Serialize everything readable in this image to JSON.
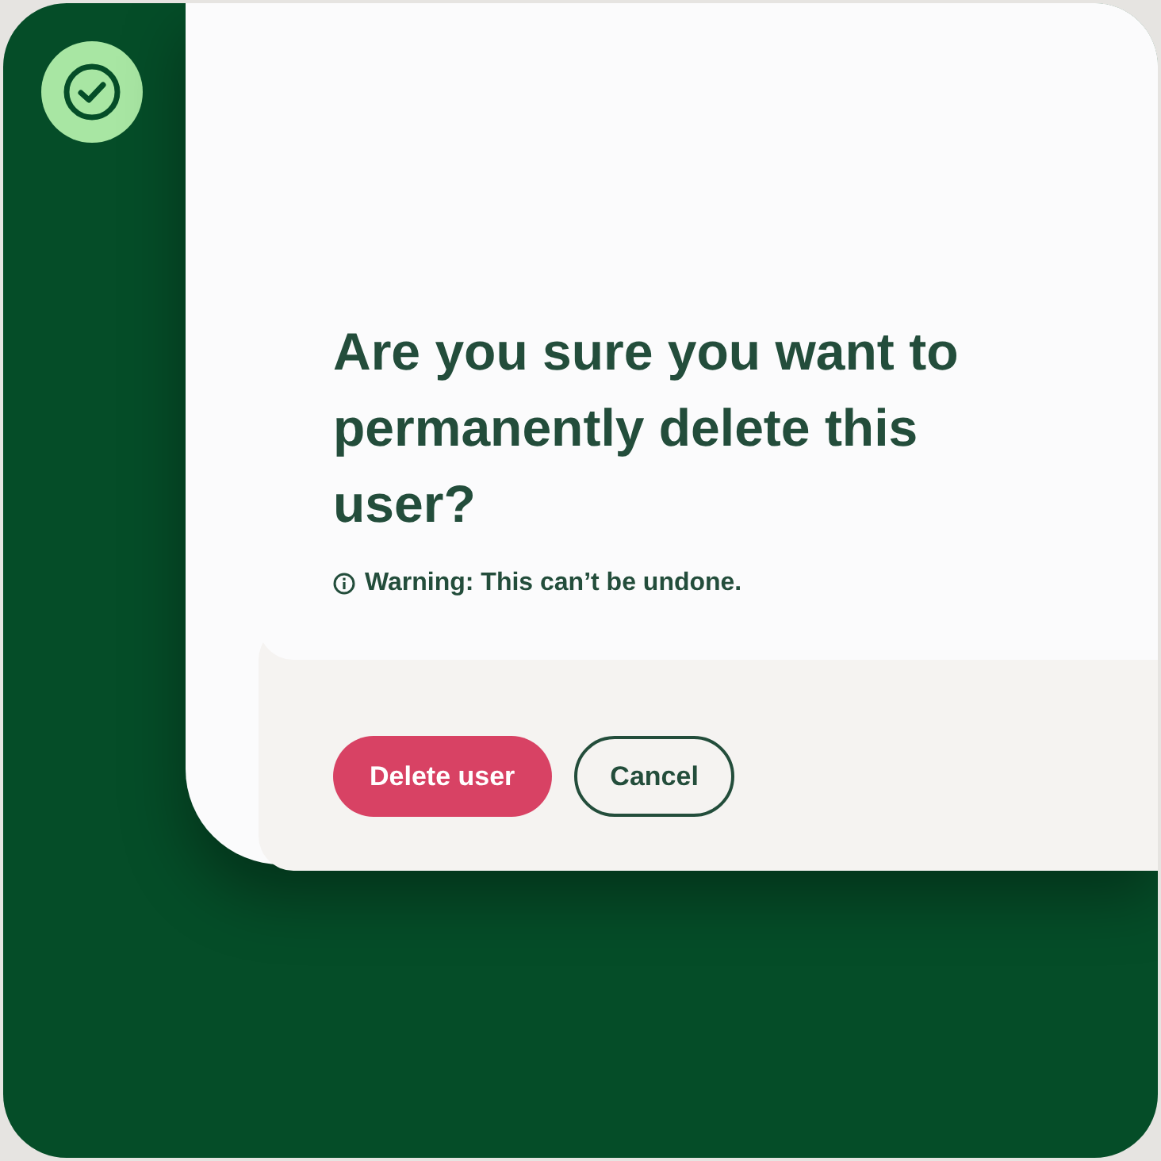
{
  "dialog": {
    "title": "Are you sure you want to permanently delete this user?",
    "warning": "Warning: This can’t be undone.",
    "buttons": [
      {
        "label": "Delete user",
        "kind": "danger"
      },
      {
        "label": "Cancel",
        "kind": "outline"
      }
    ]
  }
}
